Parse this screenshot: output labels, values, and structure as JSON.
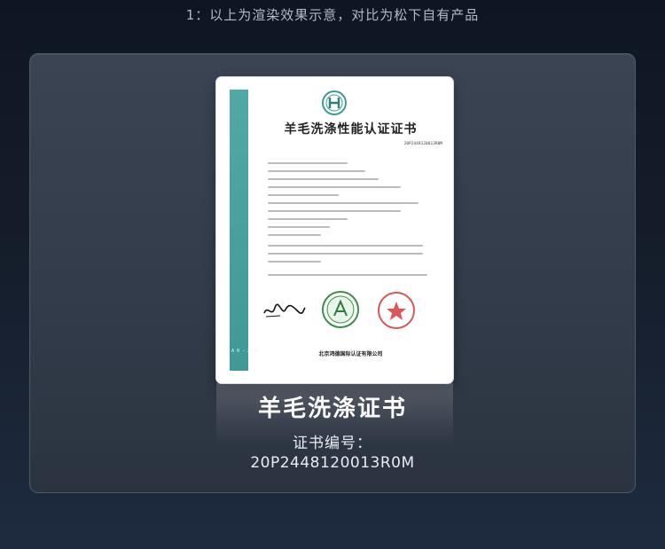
{
  "top_note": "1：以上为渲染效果示意，对比为松下自有产品",
  "certificate": {
    "title": "羊毛洗涤性能认证证书",
    "number_small": "20P2448120013R0M",
    "issuer": "北京鸿德国际认证有限公司",
    "side_bar_text": "A 0 - 2018",
    "accent_color": "#4fa9a5"
  },
  "caption": {
    "title": "羊毛洗涤证书",
    "number_label": "证书编号：",
    "number": "20P2448120013R0M"
  }
}
